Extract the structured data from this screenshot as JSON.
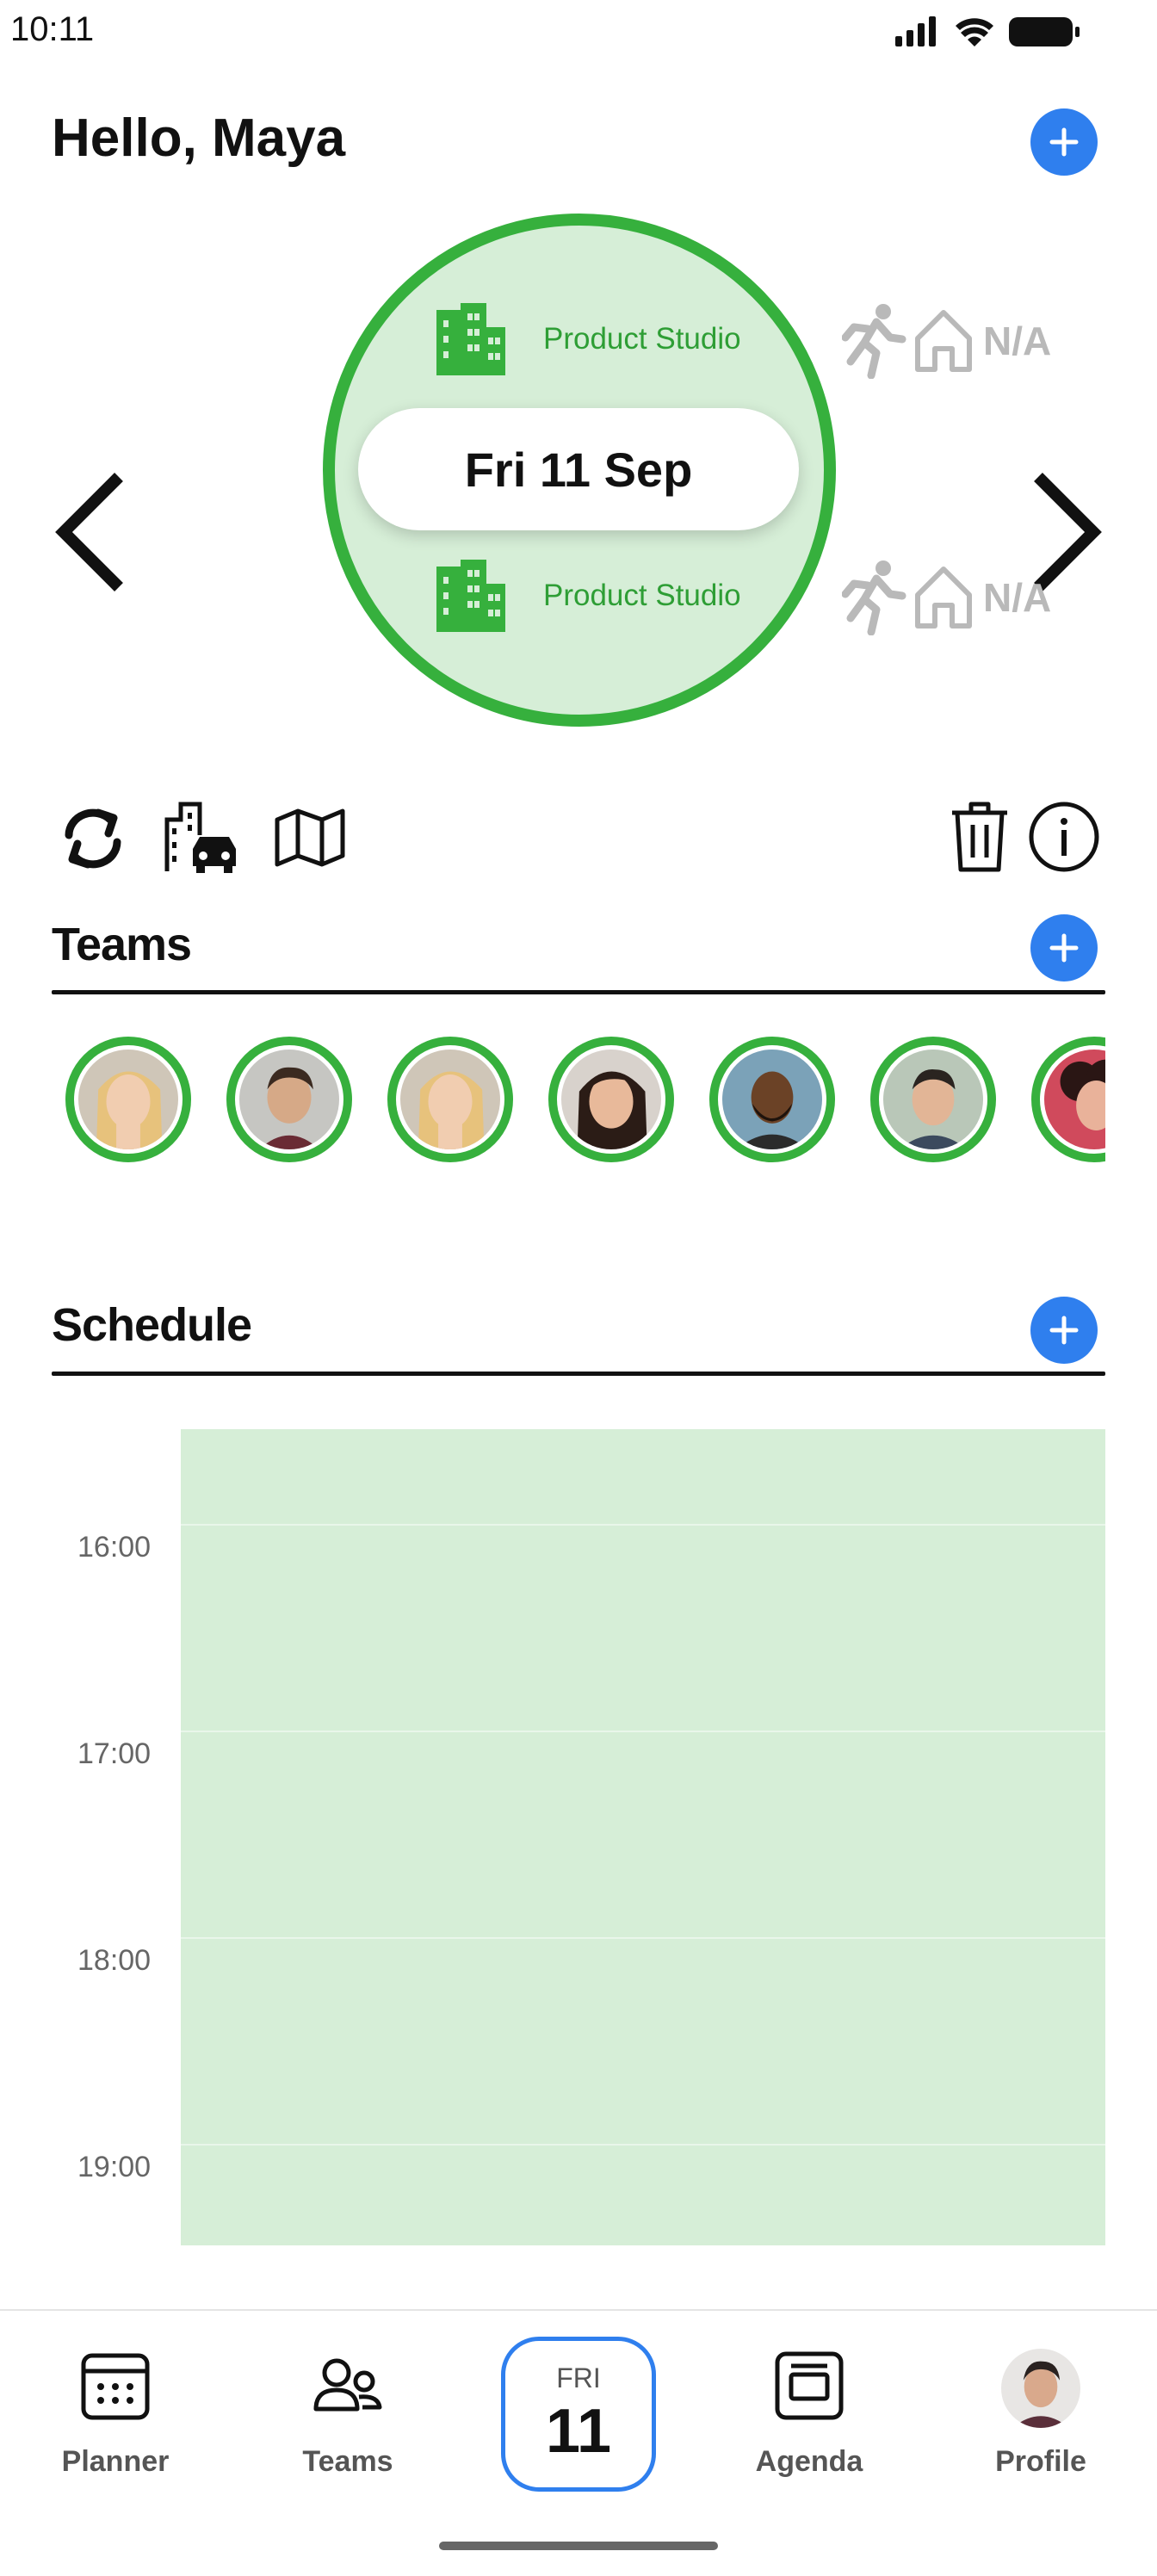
{
  "status_bar": {
    "time": "10:11"
  },
  "header": {
    "greeting": "Hello, Maya"
  },
  "day_view": {
    "date_label": "Fri 11 Sep",
    "morning_location": "Product Studio",
    "afternoon_location": "Product Studio",
    "side_morning_status": "N/A",
    "side_afternoon_status": "N/A"
  },
  "teams": {
    "title": "Teams",
    "members": [
      {
        "icon": "avatar-blonde-woman"
      },
      {
        "icon": "avatar-young-man"
      },
      {
        "icon": "avatar-blonde-woman"
      },
      {
        "icon": "avatar-dark-hair-woman"
      },
      {
        "icon": "avatar-bearded-man"
      },
      {
        "icon": "avatar-man-short-hair"
      },
      {
        "icon": "avatar-curly-hair-woman"
      }
    ]
  },
  "schedule": {
    "title": "Schedule",
    "hours": [
      "16:00",
      "17:00",
      "18:00",
      "19:00"
    ]
  },
  "bottom_nav": {
    "planner": "Planner",
    "teams": "Teams",
    "today_dow": "FRI",
    "today_day": "11",
    "agenda": "Agenda",
    "profile": "Profile"
  },
  "colors": {
    "accent_blue": "#2f7fee",
    "office_green": "#36b03d",
    "light_green": "#d6eed7",
    "inactive_gray": "#b9b9b9"
  }
}
